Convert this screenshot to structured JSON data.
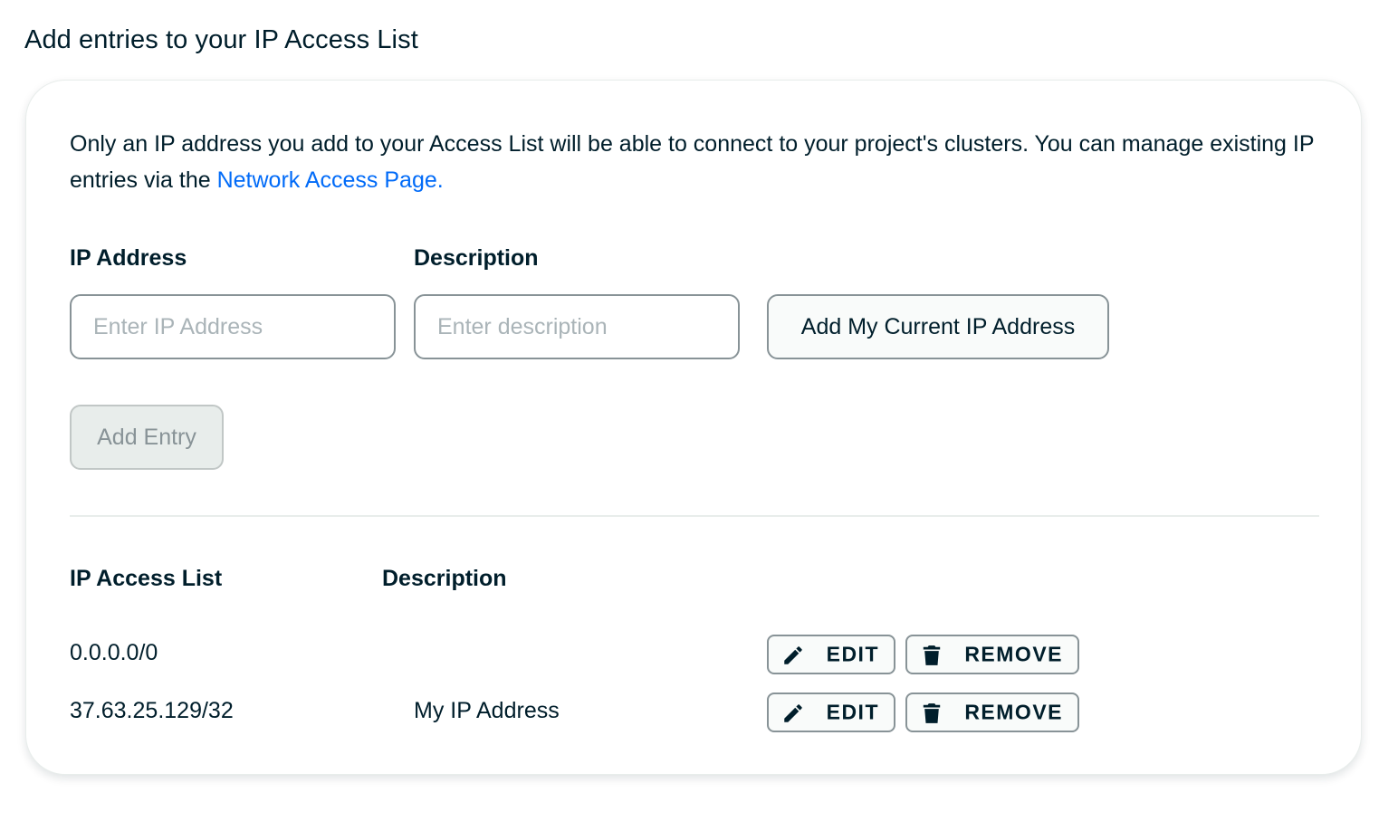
{
  "title": "Add entries to your IP Access List",
  "intro": {
    "text": "Only an IP address you add to your Access List will be able to connect to your project's clusters. You can manage existing IP entries via the ",
    "link_text": "Network Access Page."
  },
  "form": {
    "ip_label": "IP Address",
    "ip_placeholder": "Enter IP Address",
    "ip_value": "",
    "desc_label": "Description",
    "desc_placeholder": "Enter description",
    "desc_value": "",
    "add_current_ip_label": "Add My Current IP Address",
    "add_entry_label": "Add Entry"
  },
  "list": {
    "headers": {
      "ip": "IP Access List",
      "description": "Description"
    },
    "rows": [
      {
        "ip": "0.0.0.0/0",
        "description": "",
        "edit_label": "EDIT",
        "remove_label": "REMOVE"
      },
      {
        "ip": "37.63.25.129/32",
        "description": "My IP Address",
        "edit_label": "EDIT",
        "remove_label": "REMOVE"
      }
    ]
  },
  "icons": {
    "edit": "pencil-icon",
    "remove": "trash-icon"
  },
  "colors": {
    "text": "#001e2b",
    "link": "#016bf8",
    "border": "#889397",
    "disabled_bg": "#e8edeb",
    "disabled_text": "#889397"
  }
}
